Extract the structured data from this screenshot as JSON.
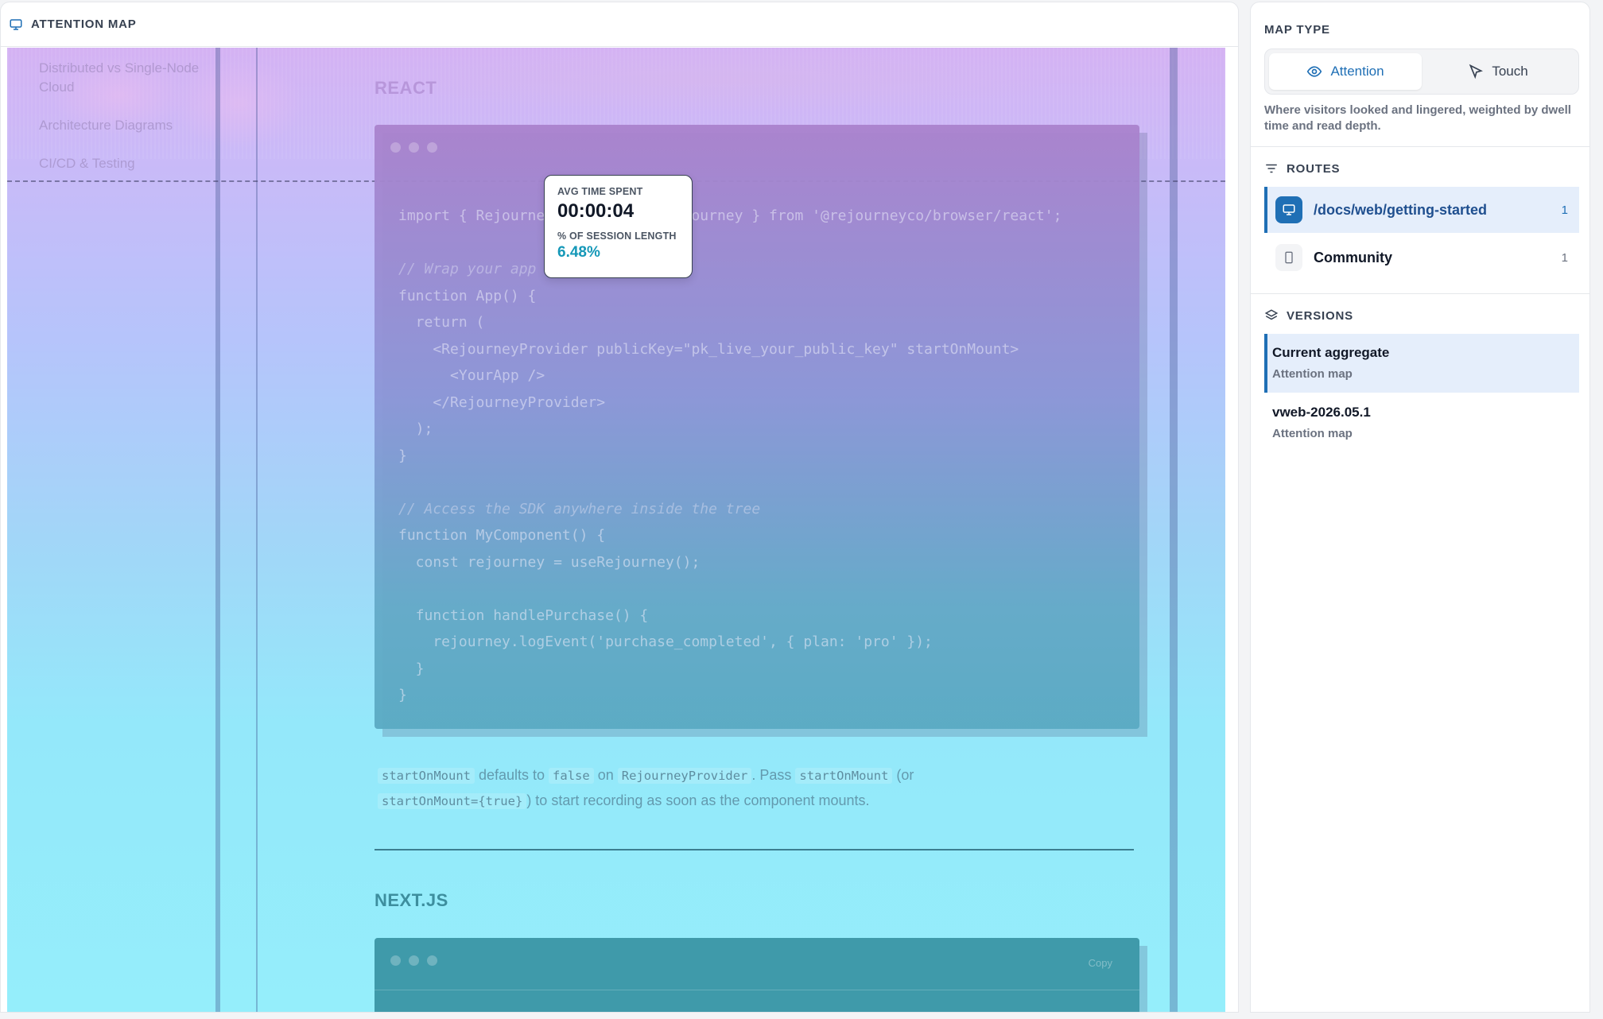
{
  "left_panel": {
    "title": "ATTENTION MAP",
    "title_icon": "monitor-icon",
    "sidebar_nav": [
      "Distributed vs Single-Node Cloud",
      "Architecture Diagrams",
      "CI/CD & Testing"
    ],
    "react_section": {
      "title": "REACT",
      "code": [
        {
          "text": "import { RejourneyProvider, useRejourney } from '@rejourneyco/browser/react';",
          "kind": "code"
        },
        {
          "text": "",
          "kind": "code"
        },
        {
          "text": "// Wrap your app root",
          "kind": "comment"
        },
        {
          "text": "function App() {",
          "kind": "code"
        },
        {
          "text": "  return (",
          "kind": "code"
        },
        {
          "text": "    <RejourneyProvider publicKey=\"pk_live_your_public_key\" startOnMount>",
          "kind": "code"
        },
        {
          "text": "      <YourApp />",
          "kind": "code"
        },
        {
          "text": "    </RejourneyProvider>",
          "kind": "code"
        },
        {
          "text": "  );",
          "kind": "code"
        },
        {
          "text": "}",
          "kind": "code"
        },
        {
          "text": "",
          "kind": "code"
        },
        {
          "text": "// Access the SDK anywhere inside the tree",
          "kind": "comment"
        },
        {
          "text": "function MyComponent() {",
          "kind": "code"
        },
        {
          "text": "  const rejourney = useRejourney();",
          "kind": "code"
        },
        {
          "text": "",
          "kind": "code"
        },
        {
          "text": "  function handlePurchase() {",
          "kind": "code"
        },
        {
          "text": "    rejourney.logEvent('purchase_completed', { plan: 'pro' });",
          "kind": "code"
        },
        {
          "text": "  }",
          "kind": "code"
        },
        {
          "text": "}",
          "kind": "code"
        }
      ]
    },
    "paragraph": {
      "c1": "startOnMount",
      "t1": " defaults to ",
      "c2": "false",
      "t2": " on ",
      "c3": "RejourneyProvider",
      "t3": ". Pass ",
      "c4": "startOnMount",
      "t4": " (or ",
      "c5": "startOnMount={true}",
      "t5": ") to start recording as soon as the component mounts."
    },
    "next_section": {
      "title": "NEXT.JS",
      "copy_label": "Copy"
    },
    "tooltip": {
      "avg_label": "AVG TIME SPENT",
      "avg_value": "00:00:04",
      "pct_label": "% OF SESSION LENGTH",
      "pct_value": "6.48%"
    }
  },
  "right_panel": {
    "map_type_title": "MAP TYPE",
    "map_types": [
      {
        "label": "Attention",
        "icon": "eye-icon",
        "active": true
      },
      {
        "label": "Touch",
        "icon": "pointer-icon",
        "active": false
      }
    ],
    "map_description": "Where visitors looked and lingered, weighted by dwell time and read depth.",
    "routes_title": "ROUTES",
    "routes": [
      {
        "label": "/docs/web/getting-started",
        "count": "1",
        "icon": "monitor-icon",
        "active": true
      },
      {
        "label": "Community",
        "count": "1",
        "icon": "phone-icon",
        "active": false
      }
    ],
    "versions_title": "VERSIONS",
    "versions": [
      {
        "name": "Current aggregate",
        "sub": "Attention map",
        "active": true
      },
      {
        "name": "vweb-2026.05.1",
        "sub": "Attention map",
        "active": false
      }
    ]
  },
  "colors": {
    "accent": "#1f6fb5",
    "tooltip_pct": "#1598b8"
  }
}
